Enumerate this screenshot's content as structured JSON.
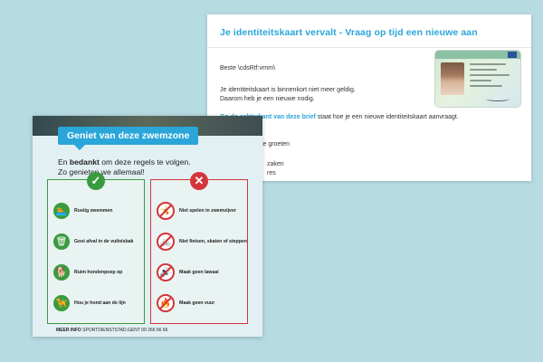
{
  "letter": {
    "title": "Je identiteitskaart vervalt - Vraag op tijd een nieuwe aan",
    "greeting": "Beste \\cdsRtf:vrnm\\",
    "line1": "Je identiteitskaart is binnenkort niet meer geldig.",
    "line2": "Daarom heb je een nieuwe nodig.",
    "link_text": "Op de achterkant van deze brief",
    "line3_rest": " staat hoe je een nieuwe identiteitskaart aanvraagt.",
    "closing": "ke groeten",
    "sign1": "zaken",
    "sign2": "res"
  },
  "poster": {
    "header": "Geniet van deze zwemzone",
    "intro_pre": "En ",
    "intro_bold": "bedankt",
    "intro_post": " om deze regels te volgen.",
    "intro_line2": "Zo genieten we allemaal!",
    "do_badge": "✓",
    "dont_badge": "✕",
    "do_items": [
      {
        "label": "Rustig zwemmen",
        "icon": "🏊"
      },
      {
        "label": "Gooi afval in de vuilnisbak",
        "icon": "🗑"
      },
      {
        "label": "Ruim hondenpoep op",
        "icon": "🐕"
      },
      {
        "label": "Hou je hond aan de lijn",
        "icon": "🦮"
      }
    ],
    "dont_items": [
      {
        "label": "Niet spelen in zwemvijver",
        "icon": "🤸"
      },
      {
        "label": "Niet fietsen, skaten of steppen",
        "icon": "🚲"
      },
      {
        "label": "Maak geen lawaai",
        "icon": "🔊"
      },
      {
        "label": "Maak geen vuur",
        "icon": "🔥"
      }
    ],
    "footer_bold": "MEER INFO",
    "footer_rest": " SPORTDIENSTSTAD.GENT 09 266 66 66"
  },
  "colors": {
    "background": "#b7dbe3",
    "accent_blue": "#2aa6d9",
    "do_green": "#3a9a3f",
    "dont_red": "#d3353b"
  }
}
